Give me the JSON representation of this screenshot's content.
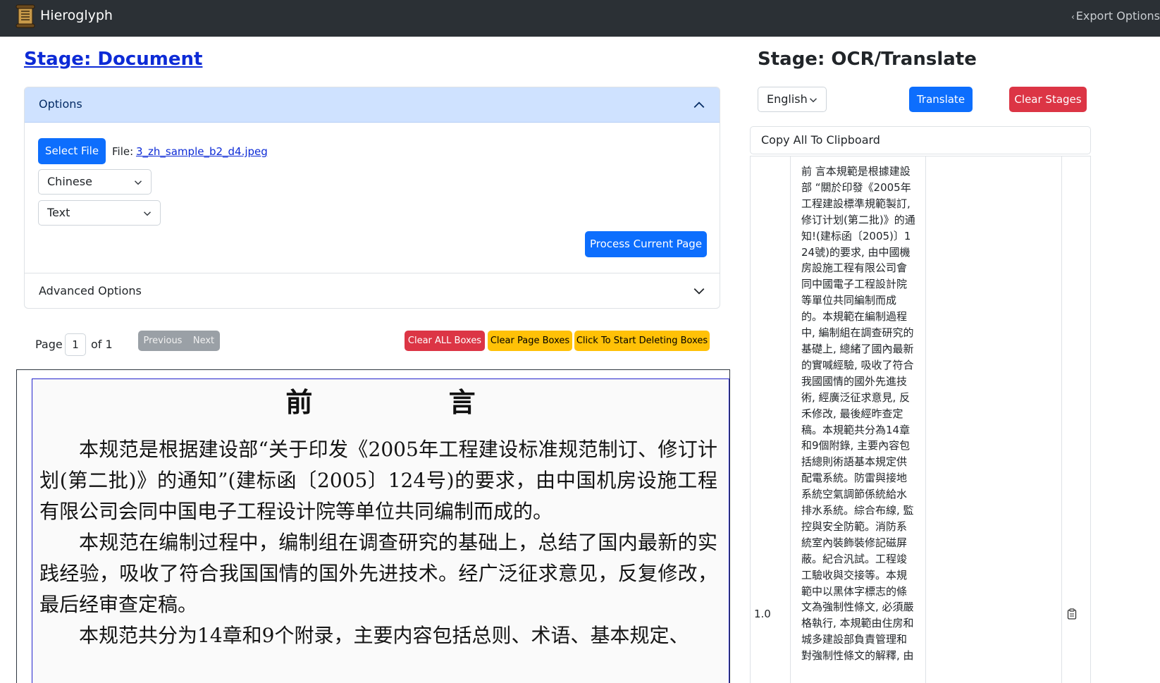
{
  "app": {
    "name": "Hieroglyph",
    "export_toggle": "Export Options"
  },
  "document_stage": {
    "title": "Stage: Document",
    "options_header": "Options",
    "select_file_button": "Select File",
    "file_label": "File:",
    "file_name": "3_zh_sample_b2_d4.jpeg",
    "source_language": "Chinese",
    "mode": "Text",
    "process_button": "Process Current Page",
    "advanced_options_header": "Advanced Options",
    "pagination": {
      "page_label": "Page",
      "current_page": "1",
      "of_label": "of 1",
      "previous": "Previous",
      "next": "Next"
    },
    "box_buttons": {
      "clear_all": "Clear ALL Boxes",
      "clear_page": "Clear Page Boxes",
      "start_deleting": "Click To Start Deleting Boxes"
    },
    "document_image": {
      "heading": "前 言",
      "paragraphs": [
        "本规范是根据建设部“关于印发《2005年工程建设标准规范制订、修订计划(第二批)》的通知”(建标函〔2005〕124号)的要求，由中国机房设施工程有限公司会同中国电子工程设计院等单位共同编制而成的。",
        "本规范在编制过程中，编制组在调查研究的基础上，总结了国内最新的实践经验，吸收了符合我国国情的国外先进技术。经广泛征求意见，反复修改，最后经审查定稿。",
        "本规范共分为14章和9个附录，主要内容包括总则、术语、基本规定、"
      ]
    }
  },
  "ocr_stage": {
    "title": "Stage: OCR/Translate",
    "target_language": "English",
    "translate_button": "Translate",
    "clear_stages_button": "Clear Stages",
    "copy_all_label": "Copy All To Clipboard",
    "results": [
      {
        "confidence": "1.0",
        "text": "前 言本規範是根據建設部 “關於印發《2005年工程建設標準規範製訂, 修订计划(第二批)》的通知!(建标函〔2005)〕124號)的要求, 由中國機房設施工程有限公司會同中國電子工程設計院等單位共同編制而成的。本規範在編制過程中, 編制組在調查研究的基礎上, 總緒了國內最新的實喊經驗, 吸收了符合我國國情的國外先進技術, 經廣泛征求意見, 反禾修改, 最後經昨查定稿。本規範共分為14章和9個附錄, 主要內容包括總則術語基本規定供配電系統。防雷與接地系統空氣調節係統給水排水系統。綜合布線, 監控與安全防範。消防系統室內裝飾裝修記磁屏蔽。紀合汎試。工程竣工驗收與交接等。本規範中以黑体字標志的條文為強制性條文, 必須嚴格執行, 本規範由住房和城多建設部負責管理和對強制性條文的解釋, 由"
      }
    ]
  },
  "colors": {
    "navbar": "#2b3035",
    "primary": "#0d6efd",
    "danger": "#dc3545",
    "warning": "#ffc107",
    "secondary": "#9aa0a6",
    "link": "#0d2bd6",
    "accordion_header": "#cfe2ff"
  }
}
